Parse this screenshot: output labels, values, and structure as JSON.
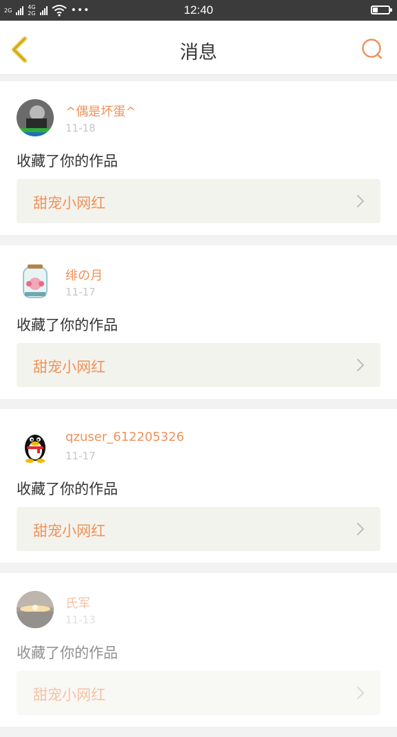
{
  "status_bar": {
    "network_top": "2G",
    "network_mid_top": "4G",
    "network_mid_bottom": "2G",
    "network_bottom": "2G",
    "more": "•••",
    "time": "12:40"
  },
  "header": {
    "title": "消息",
    "back_icon": "chevron-left-icon",
    "search_icon": "search-icon"
  },
  "colors": {
    "accent": "#f0915a",
    "back_icon": "#e8c53a",
    "card_bg": "#ffffff",
    "work_bg": "#f3f3ed"
  },
  "messages": [
    {
      "username": "^偶是坏蛋^",
      "date": "11-18",
      "action": "收藏了你的作品",
      "work_title": "甜宠小网红"
    },
    {
      "username": "绯の月",
      "date": "11-17",
      "action": "收藏了你的作品",
      "work_title": "甜宠小网红"
    },
    {
      "username": "qzuser_612205326",
      "date": "11-17",
      "action": "收藏了你的作品",
      "work_title": "甜宠小网红"
    },
    {
      "username": "氏军",
      "date": "11-13",
      "action": "收藏了你的作品",
      "work_title": "甜宠小网红"
    }
  ]
}
